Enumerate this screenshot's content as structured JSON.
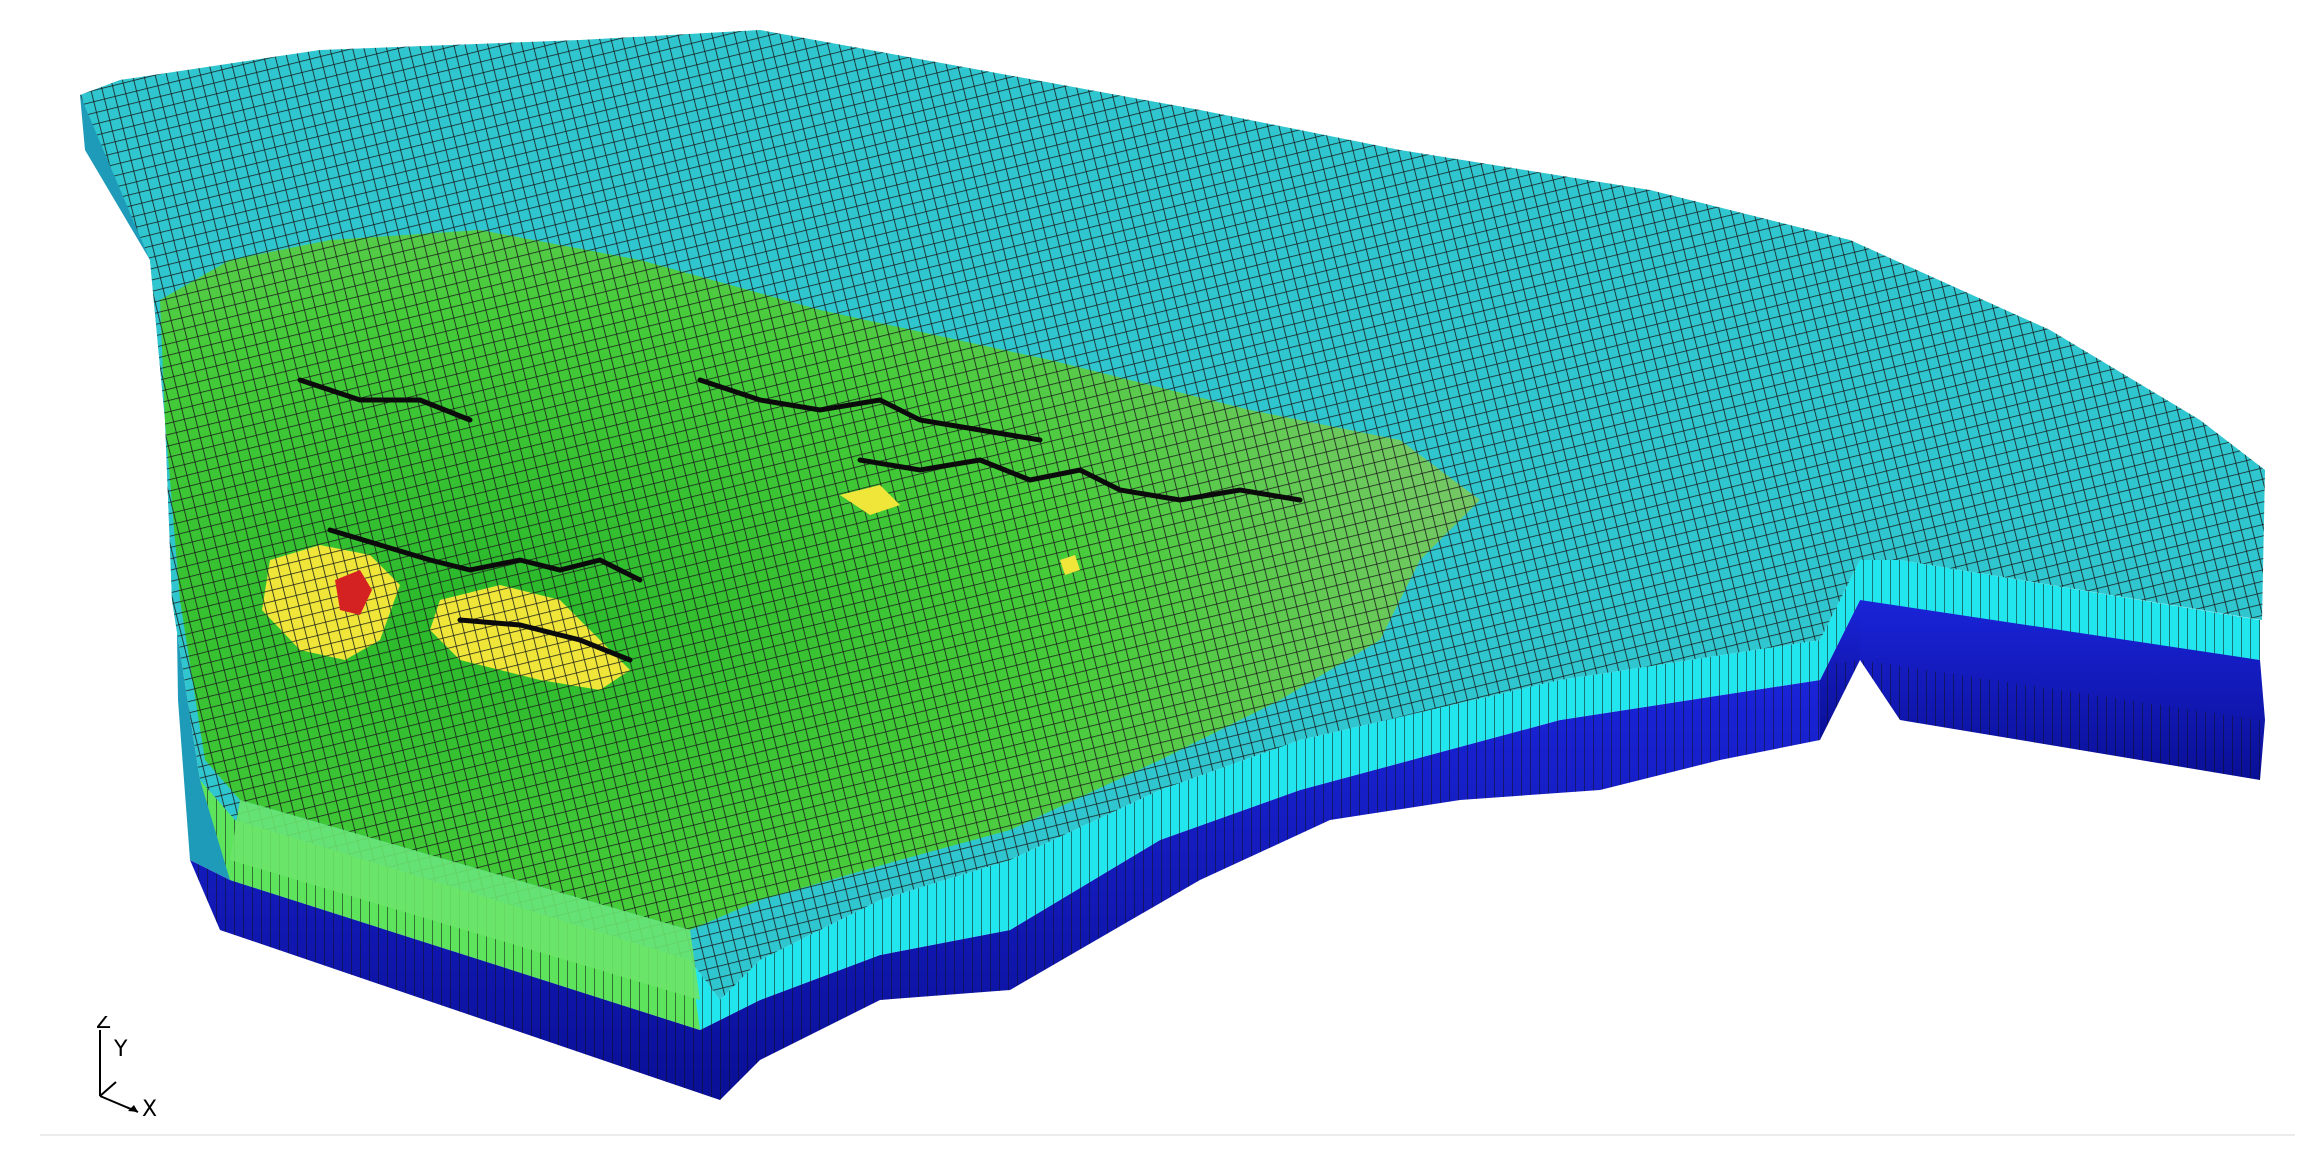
{
  "viewer": {
    "render_style": "3d-grid-block-model",
    "colors": {
      "background": "#ffffff",
      "grid_line": "#1a1a1a",
      "top_base": "#2fc6cf",
      "top_light": "#30e4ef",
      "green_dark": "#29b82b",
      "green_light": "#7bde3d",
      "yellow": "#f0e63a",
      "red": "#d42222",
      "wall_cyan": "#22e6ee",
      "wall_green": "#5ee45c",
      "wall_blue": "#1018c8",
      "wall_blue_dark": "#0a0f96"
    }
  },
  "axes": {
    "z_label": "Z",
    "y_label": "Y",
    "x_label": "X"
  }
}
